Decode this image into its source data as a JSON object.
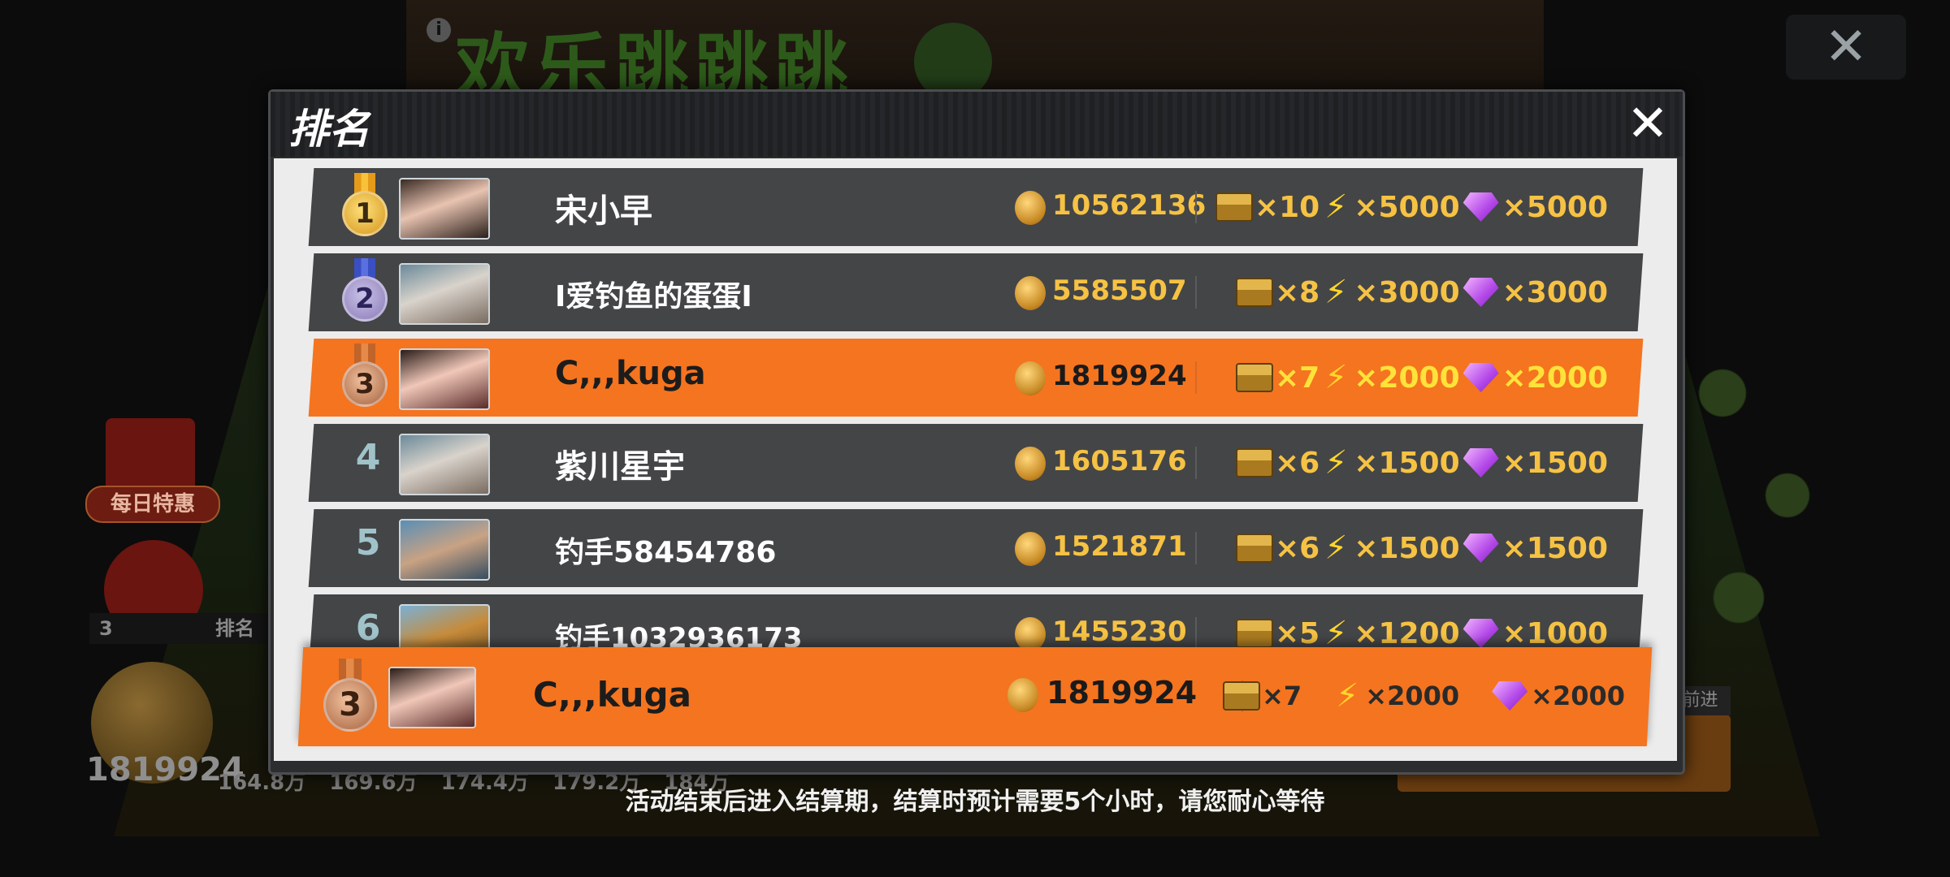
{
  "background": {
    "title": "欢乐跳跳跳",
    "info_icon": "i",
    "close_icon": "✕",
    "daily_deals": "每日特惠",
    "my_rank_position": "3",
    "rank_label": "排名",
    "coin_total": "1819924",
    "progress_marks": [
      "164.8万",
      "169.6万",
      "174.4万",
      "179.2万",
      "184万"
    ],
    "advance_label": "前进"
  },
  "modal": {
    "title": "排名",
    "close_icon": "✕"
  },
  "rows": [
    {
      "rank": "1",
      "medal": "gold",
      "name": "宋小早",
      "score": "10562136",
      "chest_qty": "×10",
      "energy_qty": "×5000",
      "gem_qty": "×5000"
    },
    {
      "rank": "2",
      "medal": "silver",
      "name": "I爱钓鱼的蛋蛋I",
      "score": "5585507",
      "chest_qty": "×8",
      "energy_qty": "×3000",
      "gem_qty": "×3000"
    },
    {
      "rank": "3",
      "medal": "bronze",
      "name": "C,,,kuga",
      "score": "1819924",
      "chest_qty": "×7",
      "energy_qty": "×2000",
      "gem_qty": "×2000"
    },
    {
      "rank": "4",
      "medal": "",
      "name": "紫川星宇",
      "score": "1605176",
      "chest_qty": "×6",
      "energy_qty": "×1500",
      "gem_qty": "×1500"
    },
    {
      "rank": "5",
      "medal": "",
      "name": "钓手58454786",
      "score": "1521871",
      "chest_qty": "×6",
      "energy_qty": "×1500",
      "gem_qty": "×1500"
    },
    {
      "rank": "6",
      "medal": "",
      "name": "钓手1032936173",
      "score": "1455230",
      "chest_qty": "×5",
      "energy_qty": "×1200",
      "gem_qty": "×1000"
    }
  ],
  "my_rank": {
    "rank": "3",
    "name": "C,,,kuga",
    "score": "1819924",
    "chest_qty": "×7",
    "energy_qty": "×2000",
    "gem_qty": "×2000"
  },
  "footer_note": "活动结束后进入结算期，结算时预计需要5个小时，请您耐心等待",
  "colors": {
    "highlight": "#f5741f",
    "row_bg": "#444547",
    "score_gold": "#f6c243"
  },
  "icons": {
    "coin": "gold-coin-icon",
    "chest": "treasure-chest-icon",
    "energy": "lightning-bolt-icon",
    "gem": "purple-diamond-icon"
  }
}
